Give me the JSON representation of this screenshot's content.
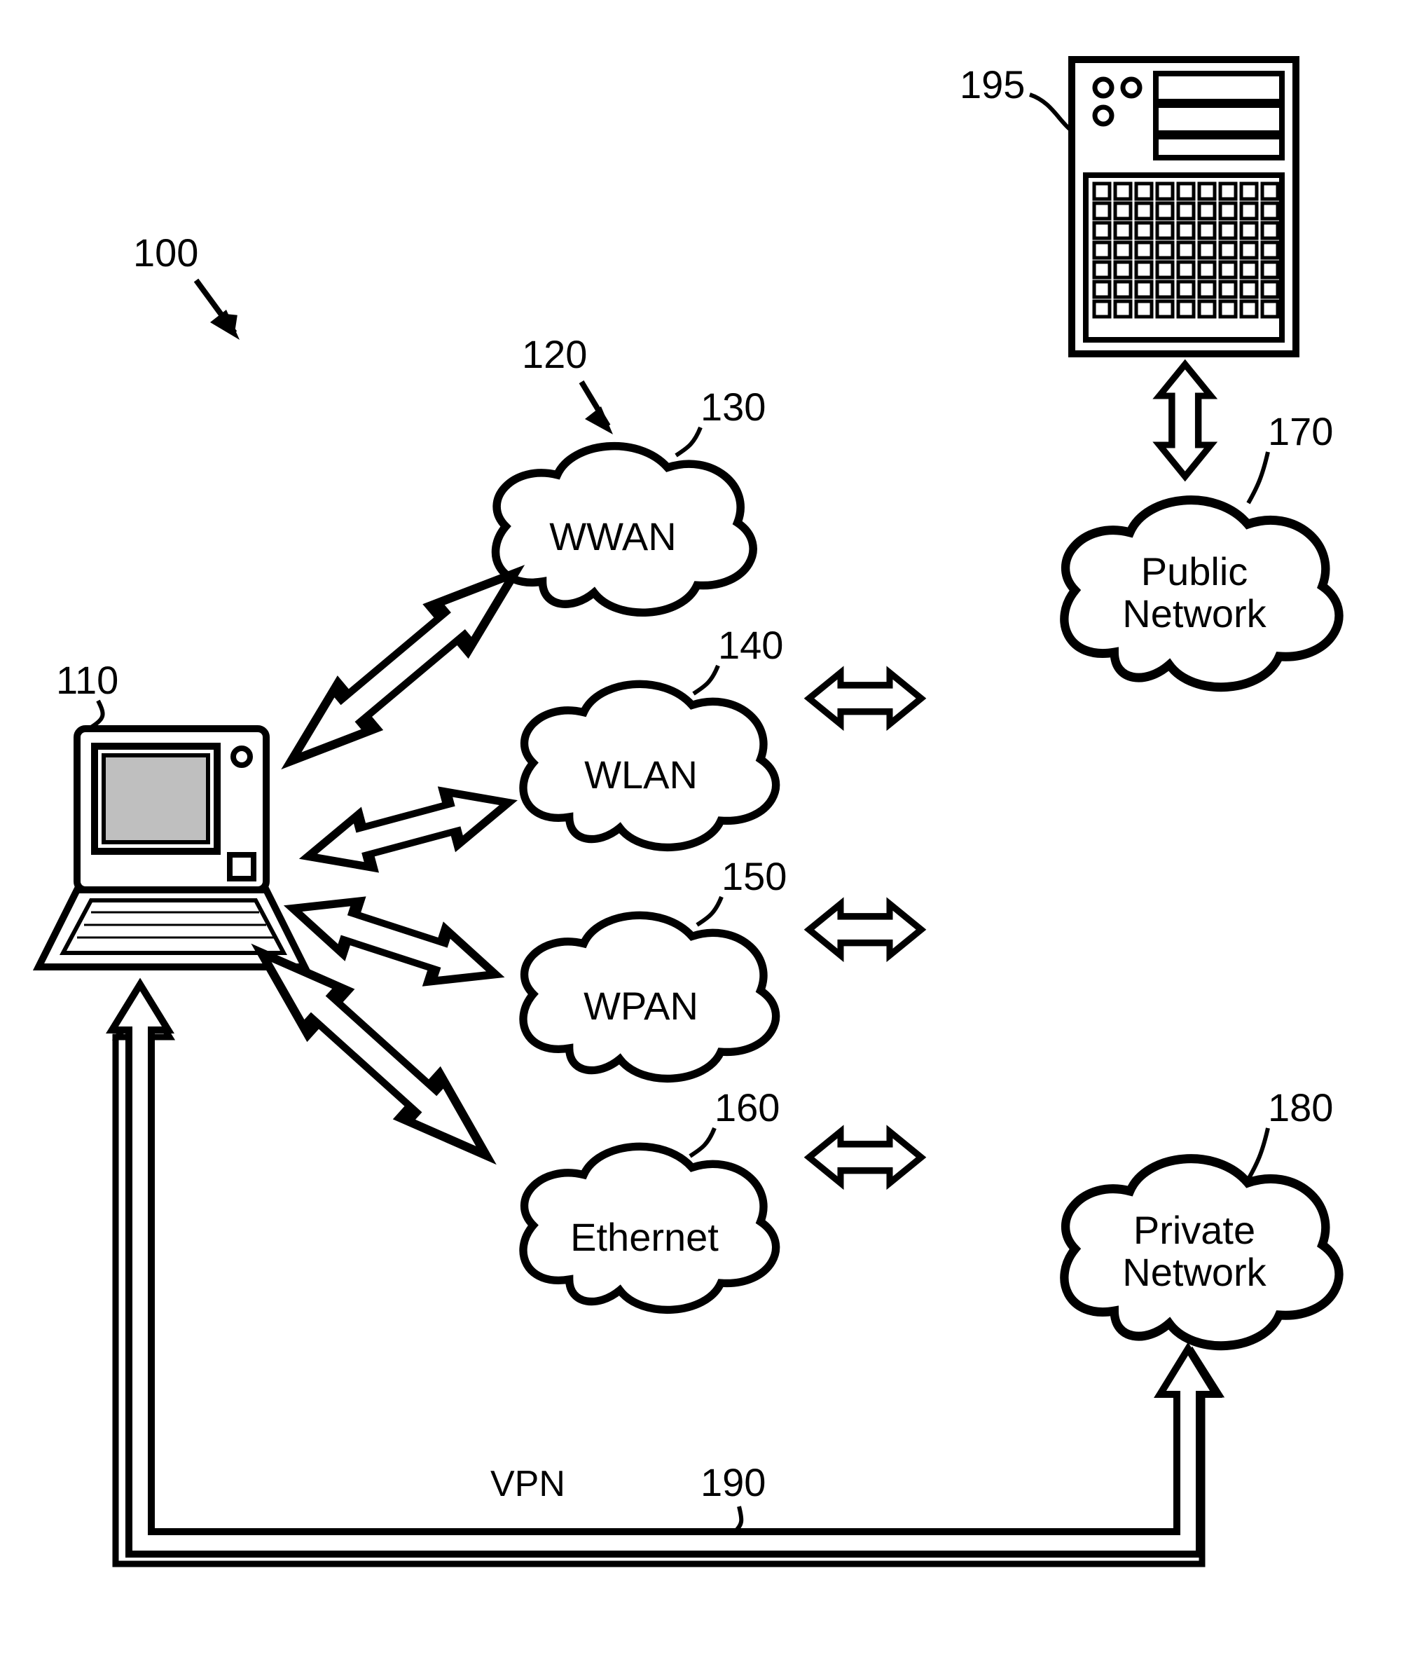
{
  "refs": {
    "r100": "100",
    "r110": "110",
    "r120": "120",
    "r130": "130",
    "r140": "140",
    "r150": "150",
    "r160": "160",
    "r170": "170",
    "r180": "180",
    "r190": "190",
    "r195": "195"
  },
  "clouds": {
    "wwan": "WWAN",
    "wlan": "WLAN",
    "wpan": "WPAN",
    "ethernet": "Ethernet",
    "public1": "Public",
    "public2": "Network",
    "private1": "Private",
    "private2": "Network"
  },
  "labels": {
    "vpn": "VPN"
  }
}
